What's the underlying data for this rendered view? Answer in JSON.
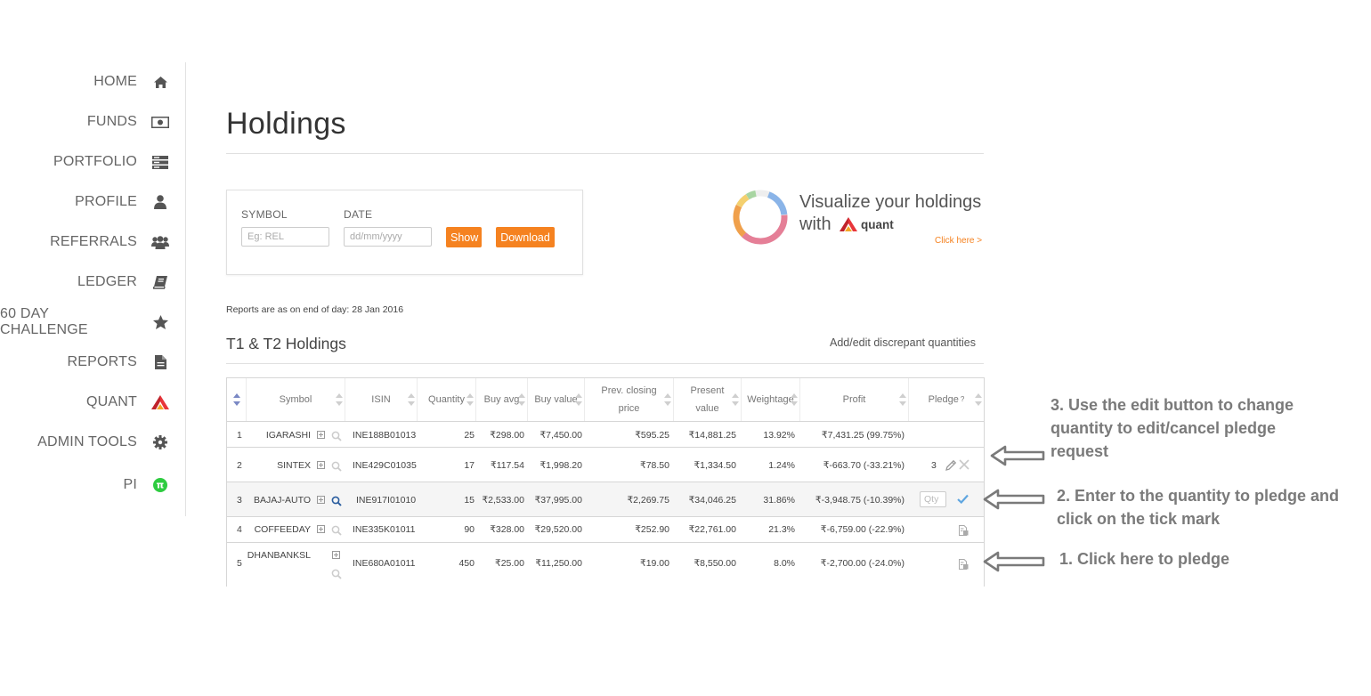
{
  "sidebar": {
    "items": [
      {
        "label": "HOME",
        "icon": "home-icon"
      },
      {
        "label": "FUNDS",
        "icon": "money-icon"
      },
      {
        "label": "PORTFOLIO",
        "icon": "portfolio-icon"
      },
      {
        "label": "PROFILE",
        "icon": "user-icon"
      },
      {
        "label": "REFERRALS",
        "icon": "users-icon"
      },
      {
        "label": "LEDGER",
        "icon": "book-icon"
      },
      {
        "label": "60 DAY CHALLENGE",
        "icon": "star-icon"
      },
      {
        "label": "REPORTS",
        "icon": "file-icon"
      },
      {
        "label": "QUANT",
        "icon": "quant-logo-icon"
      },
      {
        "label": "ADMIN TOOLS",
        "icon": "gear-icon"
      },
      {
        "label": "PI",
        "icon": "pi-icon"
      }
    ]
  },
  "page": {
    "title": "Holdings",
    "filter": {
      "symbol_label": "SYMBOL",
      "symbol_placeholder": "Eg: REL",
      "date_label": "DATE",
      "date_placeholder": "dd/mm/yyyy",
      "show_label": "Show",
      "download_label": "Download"
    },
    "visualize": {
      "line1": "Visualize your holdings",
      "line2": "with",
      "brand": "quant",
      "link": "Click here >"
    },
    "report_note": "Reports are as on end of day: 28 Jan 2016",
    "section_title": "T1 & T2 Holdings",
    "add_edit_link": "Add/edit discrepant quantities"
  },
  "table": {
    "headers": [
      "",
      "Symbol",
      "ISIN",
      "Quantity",
      "Buy avg",
      "Buy value",
      "Prev. closing price",
      "Present value",
      "Weightage",
      "Profit",
      "Pledge"
    ],
    "pledge_help": "?",
    "qty_placeholder": "Qty",
    "rows": [
      {
        "no": "1",
        "symbol": "IGARASHI",
        "isin": "INE188B01013",
        "qty": "25",
        "buy_avg": "₹298.00",
        "buy_value": "₹7,450.00",
        "prev_close": "₹595.25",
        "present_value": "₹14,881.25",
        "weightage": "13.92%",
        "profit": "₹7,431.25 (99.75%)",
        "pledge": ""
      },
      {
        "no": "2",
        "symbol": "SINTEX",
        "isin": "INE429C01035",
        "qty": "17",
        "buy_avg": "₹117.54",
        "buy_value": "₹1,998.20",
        "prev_close": "₹78.50",
        "present_value": "₹1,334.50",
        "weightage": "1.24%",
        "profit": "₹-663.70 (-33.21%)",
        "pledge": "3"
      },
      {
        "no": "3",
        "symbol": "BAJAJ-AUTO",
        "isin": "INE917I01010",
        "qty": "15",
        "buy_avg": "₹2,533.00",
        "buy_value": "₹37,995.00",
        "prev_close": "₹2,269.75",
        "present_value": "₹34,046.25",
        "weightage": "31.86%",
        "profit": "₹-3,948.75 (-10.39%)",
        "pledge": ""
      },
      {
        "no": "4",
        "symbol": "COFFEEDAY",
        "isin": "INE335K01011",
        "qty": "90",
        "buy_avg": "₹328.00",
        "buy_value": "₹29,520.00",
        "prev_close": "₹252.90",
        "present_value": "₹22,761.00",
        "weightage": "21.3%",
        "profit": "₹-6,759.00 (-22.9%)",
        "pledge": ""
      },
      {
        "no": "5",
        "symbol": "DHANBANKSL",
        "isin": "INE680A01011",
        "qty": "450",
        "buy_avg": "₹25.00",
        "buy_value": "₹11,250.00",
        "prev_close": "₹19.00",
        "present_value": "₹8,550.00",
        "weightage": "8.0%",
        "profit": "₹-2,700.00 (-24.0%)",
        "pledge": ""
      }
    ]
  },
  "annotations": {
    "step3": "3. Use the edit button to change quantity to edit/cancel pledge request",
    "step2": "2. Enter to the quantity to pledge and click on the tick mark",
    "step1": "1. Click here to pledge"
  },
  "colors": {
    "accent": "#f58220",
    "pi_badge": "#2ecc40",
    "quant_red": "#e8353a",
    "tick": "#5fa6e0"
  }
}
